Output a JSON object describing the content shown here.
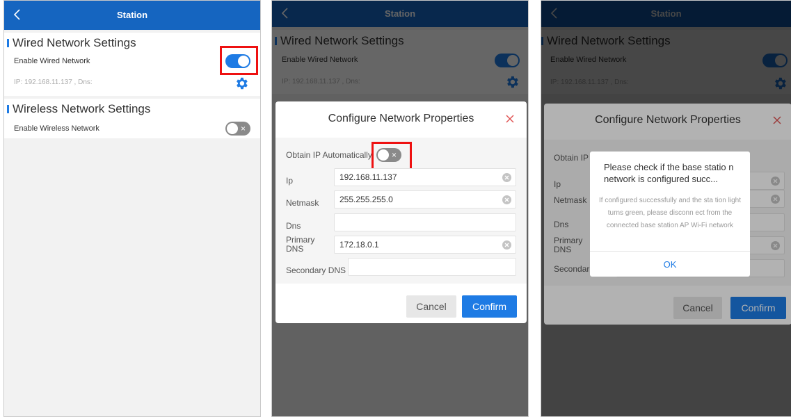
{
  "colors": {
    "primary": "#1565c0",
    "accent": "#1e7be4",
    "highlight": "#ee1111",
    "toggle_off": "#8a8a8a"
  },
  "header": {
    "title": "Station",
    "back_icon": "chevron-left-icon"
  },
  "wired": {
    "section_title": "Wired Network Settings",
    "enable_label": "Enable Wired Network",
    "enabled": true,
    "ip_text": "IP: 192.168.11.137 , Dns:",
    "settings_icon": "gear-icon"
  },
  "wireless": {
    "section_title": "Wireless Network Settings",
    "enable_label": "Enable Wireless Network",
    "enabled": false
  },
  "config_dialog": {
    "title": "Configure Network Properties",
    "close_icon": "close-icon",
    "obtain_ip_label": "Obtain IP Automatically",
    "obtain_ip_enabled": false,
    "fields": {
      "ip": {
        "label": "Ip",
        "value": "192.168.11.137"
      },
      "netmask": {
        "label": "Netmask",
        "value": "255.255.255.0"
      },
      "dns": {
        "label": "Dns",
        "value": ""
      },
      "primary_dns": {
        "label": "Primary DNS",
        "value": "172.18.0.1"
      },
      "secondary_dns": {
        "label": "Secondary DNS",
        "value": ""
      }
    },
    "cancel_label": "Cancel",
    "confirm_label": "Confirm"
  },
  "phone3_partial_labels": {
    "obtain_ip": "Obtain IP",
    "secondary": "Secondar"
  },
  "alert": {
    "title": "Please check if the base statio n network is configured succ...",
    "message": "If configured successfully and the sta tion light turns green, please disconn ect from the connected base station AP Wi-Fi network",
    "ok_label": "OK"
  }
}
